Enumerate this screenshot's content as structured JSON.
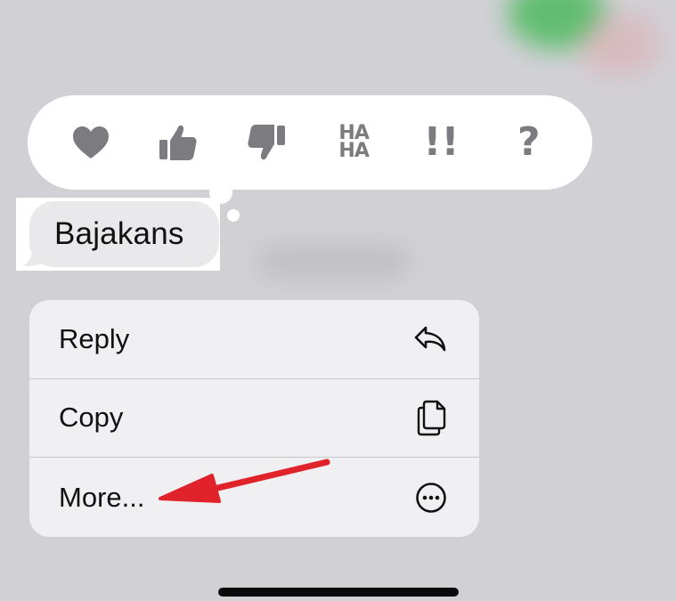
{
  "tapbacks": [
    {
      "name": "heart",
      "icon": "heart-icon"
    },
    {
      "name": "thumbs-up",
      "icon": "thumbs-up-icon"
    },
    {
      "name": "thumbs-down",
      "icon": "thumbs-down-icon"
    },
    {
      "name": "haha",
      "icon": "haha-icon",
      "line1": "HA",
      "line2": "HA"
    },
    {
      "name": "emphasize",
      "icon": "double-exclamation-icon",
      "text": "!!"
    },
    {
      "name": "question",
      "icon": "question-mark-icon",
      "text": "?"
    }
  ],
  "message": {
    "text": "Bajakans"
  },
  "context_menu": {
    "items": [
      {
        "label": "Reply",
        "icon": "reply-icon"
      },
      {
        "label": "Copy",
        "icon": "copy-icon"
      },
      {
        "label": "More...",
        "icon": "ellipsis-circle-icon"
      }
    ]
  },
  "colors": {
    "background": "#d1d0d5",
    "tapback_icon": "#7b7b80",
    "menu_bg": "#f0f0f2",
    "bubble_bg": "#e9e9eb",
    "annotation_arrow": "#e0222b"
  }
}
